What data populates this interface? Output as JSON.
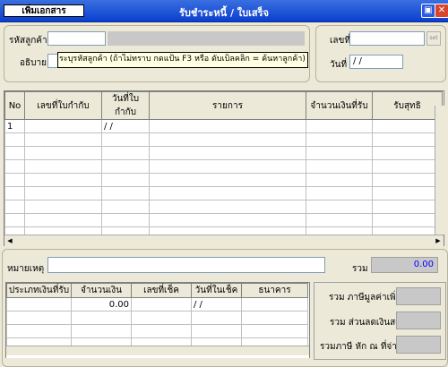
{
  "window": {
    "title": "รับชำระหนี้ / ใบเสร็จ",
    "new_doc_label": "เพิ่มเอกสาร",
    "maximize_glyph": "▣",
    "close_glyph": "✕"
  },
  "header": {
    "customer_code_label": "รหัสลูกค้า",
    "customer_code_value": "",
    "customer_name_value": "",
    "description_label": "อธิบาย",
    "hint_text": "ระบุรหัสลูกค้า (ถ้าไม่ทราบ กดแป้น F3  หรือ ดับเบิลคลิก = ค้นหาลูกค้า)",
    "doc_no_label": "เลขที่",
    "doc_no_value": "",
    "doc_no_button": "set",
    "date_label": "วันที่",
    "date_value": " / /"
  },
  "main_table": {
    "columns": [
      "No",
      "เลขที่ใบกำกับ",
      "วันที่ใบกำกับ",
      "รายการ",
      "จำนวนเงินที่รับ",
      "รับสุทธิ"
    ],
    "rows": [
      [
        "1",
        "",
        " / /",
        "",
        "",
        ""
      ]
    ]
  },
  "footer": {
    "remark_label": "หมายเหตุ",
    "remark_value": "",
    "total_label": "รวม",
    "total_value": "0.00"
  },
  "payment_table": {
    "columns": [
      "ประเภทเงินที่รับ",
      "จำนวนเงิน",
      "เลขที่เช็ค",
      "วันที่ในเช็ค",
      "ธนาคาร"
    ],
    "rows": [
      [
        "",
        "0.00",
        "",
        " / /",
        ""
      ]
    ]
  },
  "summary": {
    "vat_label": "รวม ภาษีมูลค่าเพิ่ม",
    "discount_label": "รวม ส่วนลดเงินสด",
    "withholding_label": "รวมภาษี หัก ณ ที่จ่าย"
  }
}
